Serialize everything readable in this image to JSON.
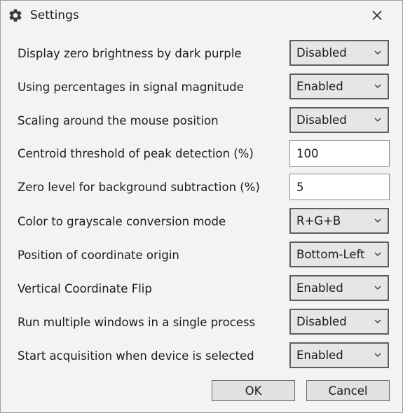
{
  "window": {
    "title": "Settings",
    "title_icon": "gear-icon",
    "close_icon": "close-icon"
  },
  "settings": [
    {
      "label": "Display zero brightness by dark purple",
      "control": "select",
      "value": "Disabled"
    },
    {
      "label": "Using percentages in signal magnitude",
      "control": "select",
      "value": "Enabled"
    },
    {
      "label": "Scaling around the mouse position",
      "control": "select",
      "value": "Disabled"
    },
    {
      "label": "Centroid threshold of peak detection (%)",
      "control": "input",
      "value": "100"
    },
    {
      "label": "Zero level for background subtraction (%)",
      "control": "input",
      "value": "5"
    },
    {
      "label": "Color to grayscale conversion mode",
      "control": "select",
      "value": "R+G+B"
    },
    {
      "label": "Position of coordinate origin",
      "control": "select",
      "value": "Bottom-Left"
    },
    {
      "label": "Vertical Coordinate Flip",
      "control": "select",
      "value": "Enabled"
    },
    {
      "label": "Run multiple windows in a single process",
      "control": "select",
      "value": "Disabled"
    },
    {
      "label": "Start acquisition when device is selected",
      "control": "select",
      "value": "Enabled"
    }
  ],
  "buttons": {
    "ok_label": "OK",
    "cancel_label": "Cancel"
  }
}
